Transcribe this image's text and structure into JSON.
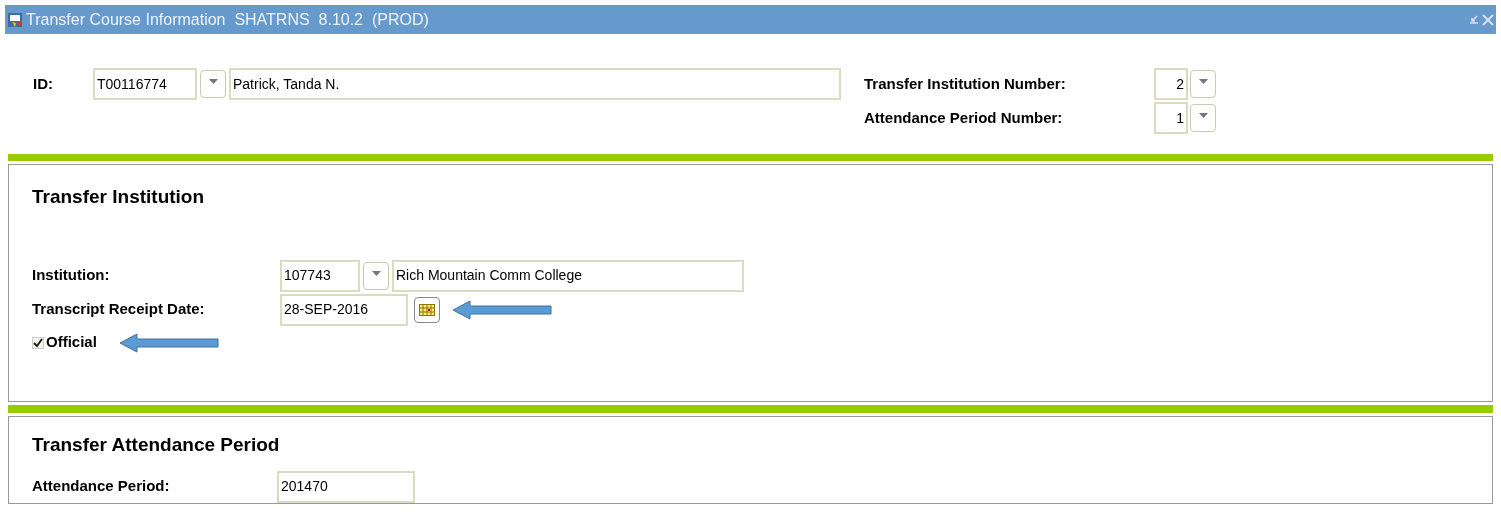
{
  "window": {
    "title": "Transfer Course Information  SHATRNS  8.10.2  (PROD)"
  },
  "key_block": {
    "id_label": "ID:",
    "id_value": "T00116774",
    "name_value": "Patrick, Tanda N.",
    "fields": [
      {
        "label": "Transfer Institution Number:",
        "value": "2"
      },
      {
        "label": "Attendance Period Number:",
        "value": "1"
      }
    ]
  },
  "transfer_institution": {
    "heading": "Transfer Institution",
    "institution_label": "Institution:",
    "institution_code": "107743",
    "institution_name": "Rich Mountain Comm College",
    "date_label": "Transcript Receipt Date:",
    "date_value": "28-SEP-2016",
    "official": {
      "label": "Official",
      "checked": true
    }
  },
  "transfer_attendance_period": {
    "heading": "Transfer Attendance Period",
    "attendance_label": "Attendance Period:",
    "attendance_value": "201470"
  }
}
